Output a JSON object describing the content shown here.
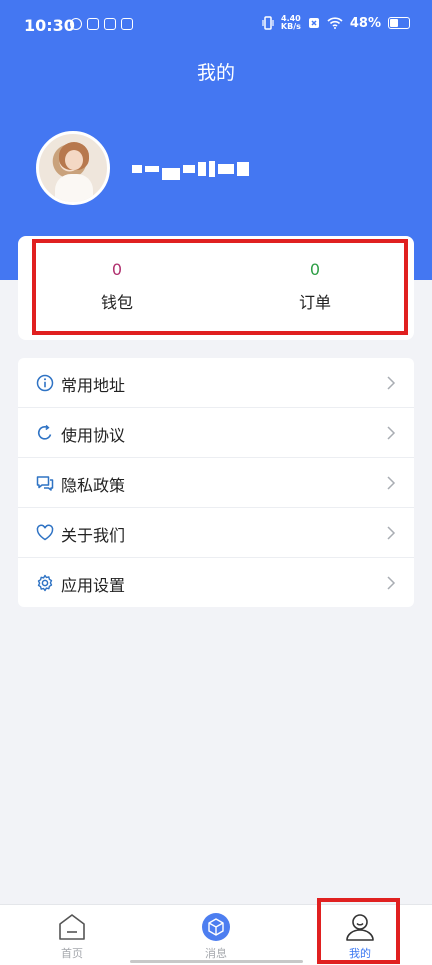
{
  "status_bar": {
    "time": "10:30",
    "net_speed_value": "4.40",
    "net_speed_unit": "KB/s",
    "battery": "48%",
    "battery_level": 0.48
  },
  "header": {
    "title": "我的"
  },
  "profile": {
    "username_masked": true
  },
  "stats": {
    "wallet": {
      "value": "0",
      "label": "钱包",
      "color": "#b0306e"
    },
    "orders": {
      "value": "0",
      "label": "订单",
      "color": "#2e9f46"
    }
  },
  "menu": [
    {
      "label": "常用地址",
      "icon": "info-icon"
    },
    {
      "label": "使用协议",
      "icon": "refresh-icon"
    },
    {
      "label": "隐私政策",
      "icon": "chat-icon"
    },
    {
      "label": "关于我们",
      "icon": "heart-icon"
    },
    {
      "label": "应用设置",
      "icon": "gear-icon"
    }
  ],
  "tabbar": {
    "tabs": [
      {
        "label": "首页",
        "icon": "home-icon",
        "active": false
      },
      {
        "label": "消息",
        "icon": "message-icon",
        "active": false
      },
      {
        "label": "我的",
        "icon": "user-icon",
        "active": true
      }
    ]
  },
  "colors": {
    "header": "#4477f2",
    "accent": "#3b78f2",
    "highlight": "#e02020",
    "icon": "#2f73c4"
  }
}
